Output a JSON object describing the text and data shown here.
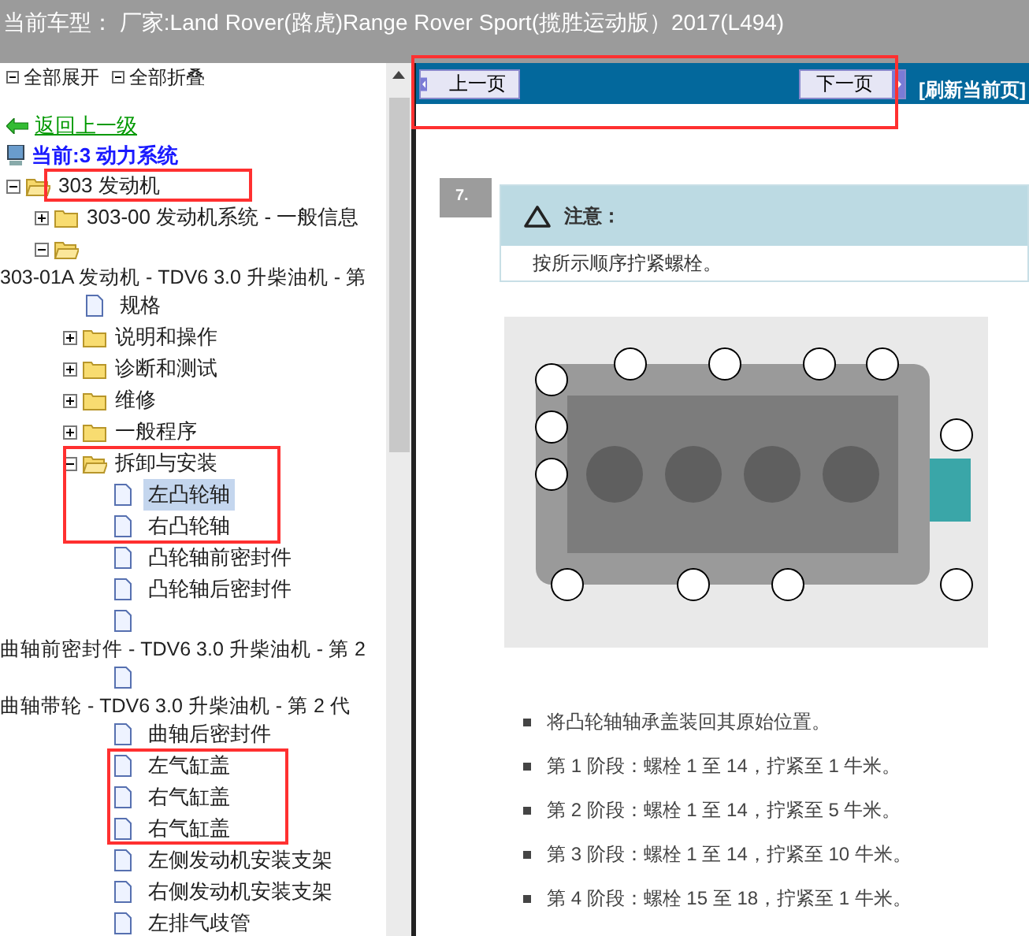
{
  "title_bar": {
    "text": "当前车型： 厂家:Land Rover(路虎)Range Rover Sport(揽胜运动版）2017(L494)"
  },
  "sidebar": {
    "toolbar": [
      "全部展开",
      "全部折叠"
    ],
    "back_link": "返回上一级",
    "current": "当前:3 动力系统",
    "tree": [
      {
        "kind": "folder",
        "label": "303 发动机",
        "expanded": true,
        "children": [
          {
            "kind": "folder",
            "label": "303-00 发动机系统 - 一般信息",
            "expanded": false
          },
          {
            "kind": "folder",
            "label": "303-01A 发动机 - TDV6 3.0 升柴油机 - 第",
            "label_below": true,
            "expanded": true,
            "children": [
              {
                "kind": "doc",
                "label": "规格",
                "selected": false
              },
              {
                "kind": "folder",
                "label": "说明和操作",
                "expanded": false
              },
              {
                "kind": "folder",
                "label": "诊断和测试",
                "expanded": false
              },
              {
                "kind": "folder",
                "label": "维修",
                "expanded": false
              },
              {
                "kind": "folder",
                "label": "一般程序",
                "expanded": false
              },
              {
                "kind": "folder",
                "label": "拆卸与安装",
                "expanded": true,
                "children": [
                  {
                    "kind": "doc",
                    "label": "左凸轮轴",
                    "selected": true
                  },
                  {
                    "kind": "doc",
                    "label": "右凸轮轴",
                    "selected": false
                  },
                  {
                    "kind": "doc",
                    "label": "凸轮轴前密封件",
                    "selected": false
                  },
                  {
                    "kind": "doc",
                    "label": "凸轮轴后密封件",
                    "selected": false
                  },
                  {
                    "kind": "doc",
                    "label": "曲轴前密封件 - TDV6 3.0 升柴油机 - 第 2",
                    "label_below": true,
                    "selected": false
                  },
                  {
                    "kind": "doc",
                    "label": "曲轴带轮 - TDV6 3.0 升柴油机 - 第 2 代",
                    "label_below": true,
                    "selected": false
                  },
                  {
                    "kind": "doc",
                    "label": "曲轴后密封件",
                    "selected": false
                  },
                  {
                    "kind": "doc",
                    "label": "左气缸盖",
                    "selected": false
                  },
                  {
                    "kind": "doc",
                    "label": "右气缸盖",
                    "selected": false
                  },
                  {
                    "kind": "doc",
                    "label": "右气缸盖",
                    "selected": false
                  },
                  {
                    "kind": "doc",
                    "label": "左侧发动机安装支架",
                    "selected": false
                  },
                  {
                    "kind": "doc",
                    "label": "右侧发动机安装支架",
                    "selected": false
                  },
                  {
                    "kind": "doc",
                    "label": "左排气歧管",
                    "selected": false
                  }
                ]
              }
            ]
          }
        ]
      }
    ]
  },
  "nav": {
    "prev": "上一页",
    "next": "下一页",
    "refresh": "[刷新当前页]"
  },
  "document": {
    "step": "7.",
    "notice_title": "注意：",
    "notice_text": "按所示顺序拧紧螺栓。",
    "bullets": [
      "将凸轮轴轴承盖装回其原始位置。",
      "第 1 阶段：螺栓 1 至 14，拧紧至 1 牛米。",
      "第 2 阶段：螺栓 1 至 14，拧紧至 5 牛米。",
      "第 3 阶段：螺栓 1 至 14，拧紧至 10 牛米。",
      "第 4 阶段：螺栓 15 至 18，拧紧至 1 牛米。"
    ]
  }
}
